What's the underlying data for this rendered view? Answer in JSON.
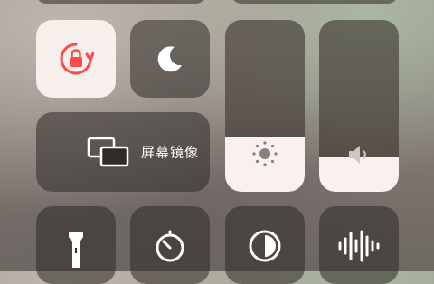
{
  "control_center": {
    "screen_mirroring": {
      "label": "屏幕镜像"
    },
    "brightness": {
      "level_percent": 32
    },
    "volume": {
      "level_percent": 20
    },
    "colors": {
      "lock_accent": "#ff4a4a",
      "active_tile": "#f6efeb",
      "tile_bg": "rgba(48,42,40,0.55)"
    },
    "icons": [
      "rotation-lock-icon",
      "moon-icon",
      "screen-mirroring-icon",
      "sun-icon",
      "speaker-icon",
      "flashlight-icon",
      "timer-icon",
      "dark-mode-icon",
      "sound-recognition-icon"
    ]
  }
}
